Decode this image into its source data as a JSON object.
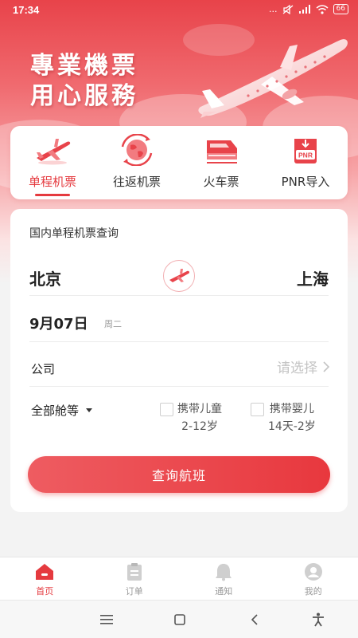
{
  "status_bar": {
    "time": "17:34",
    "signal_text": "...",
    "battery": "66"
  },
  "hero": {
    "slogan_line1": "專業機票",
    "slogan_line2": "用心服務"
  },
  "categories": [
    {
      "label": "单程机票",
      "icon": "single-trip-plane-icon",
      "active": true
    },
    {
      "label": "往返机票",
      "icon": "round-trip-globe-icon",
      "active": false
    },
    {
      "label": "火车票",
      "icon": "train-ticket-icon",
      "active": false
    },
    {
      "label": "PNR导入",
      "icon": "pnr-import-icon",
      "icon_text": "PNR",
      "active": false
    }
  ],
  "search": {
    "title": "国内单程机票查询",
    "from_city": "北京",
    "to_city": "上海",
    "date": "9月07日",
    "weekday": "周二",
    "company_label": "公司",
    "company_placeholder": "请选择",
    "cabin_class": "全部舱等",
    "child_option_line1": "携带儿童",
    "child_option_line2": "2-12岁",
    "infant_option_line1": "携带婴儿",
    "infant_option_line2": "14天-2岁",
    "search_button": "查询航班"
  },
  "bottom_nav": [
    {
      "label": "首页",
      "icon": "home-icon",
      "active": true
    },
    {
      "label": "订单",
      "icon": "order-clipboard-icon",
      "active": false
    },
    {
      "label": "通知",
      "icon": "bell-icon",
      "active": false
    },
    {
      "label": "我的",
      "icon": "profile-icon",
      "active": false
    }
  ],
  "system_nav": [
    "menu-icon",
    "home-square-icon",
    "back-icon",
    "accessibility-icon"
  ],
  "colors": {
    "brand_red": "#e53a3f",
    "hero_top": "#e8434a",
    "muted_text": "#999999"
  }
}
